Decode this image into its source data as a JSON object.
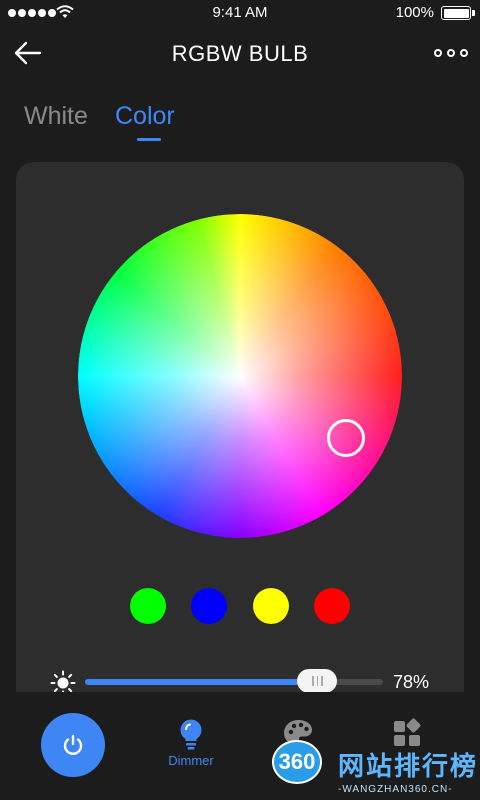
{
  "status_bar": {
    "time": "9:41 AM",
    "battery": "100%"
  },
  "header": {
    "title": "RGBW BULB"
  },
  "tabs": [
    {
      "label": "White",
      "active": false
    },
    {
      "label": "Color",
      "active": true
    }
  ],
  "color_wheel": {
    "selected_color": "#ff7fe6"
  },
  "swatches": [
    {
      "color": "#00ff00"
    },
    {
      "color": "#0000ff"
    },
    {
      "color": "#ffff00"
    },
    {
      "color": "#ff0000"
    }
  ],
  "brightness": {
    "value": 78,
    "label": "78%"
  },
  "bottom_nav": {
    "items": [
      {
        "label": "Dimmer",
        "icon": "bulb-icon",
        "active": true
      },
      {
        "label": "",
        "icon": "palette-icon",
        "active": false
      },
      {
        "label": "",
        "icon": "grid-icon",
        "active": false
      }
    ]
  },
  "watermark": {
    "badge": "360",
    "title": "网站排行榜",
    "subtitle": "-WANGZHAN360.CN-"
  },
  "colors": {
    "accent": "#3f86f5",
    "background": "#1c1c1c",
    "panel": "#2d2d2d"
  }
}
